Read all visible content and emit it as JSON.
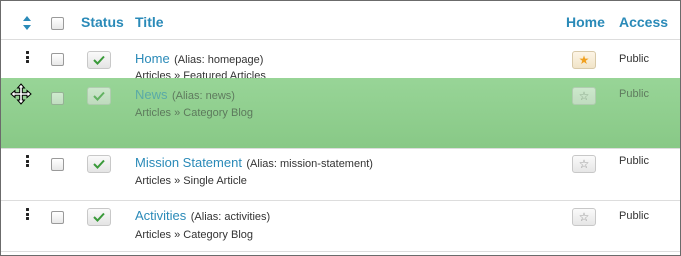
{
  "header": {
    "status_label": "Status",
    "title_label": "Title",
    "home_label": "Home",
    "access_label": "Access"
  },
  "rows": [
    {
      "title": "Home",
      "alias": "(Alias: homepage)",
      "category": "Articles » Featured Articles",
      "home_featured": true,
      "access": "Public",
      "published": true,
      "dragging": false
    },
    {
      "title": "News",
      "alias": "(Alias: news)",
      "category": "Articles » Category Blog",
      "home_featured": false,
      "access": "Public",
      "published": true,
      "dragging": true
    },
    {
      "title": "Mission Statement",
      "alias": "(Alias: mission-statement)",
      "category": "Articles » Single Article",
      "home_featured": false,
      "access": "Public",
      "published": true,
      "dragging": false
    },
    {
      "title": "Activities",
      "alias": "(Alias: activities)",
      "category": "Articles » Category Blog",
      "home_featured": false,
      "access": "Public",
      "published": true,
      "dragging": false
    }
  ],
  "icons": {
    "sort": "sort-icon",
    "drag_handle": "drag-handle-icon",
    "check": "check-icon",
    "star_filled": "star-filled-icon",
    "star_outline": "star-outline-icon",
    "move_cursor": "move-cursor-icon"
  },
  "colors": {
    "link": "#2a8ab8",
    "drag_highlight": "#8fd18e",
    "check": "#3a9a3a",
    "featured_star": "#f0a020"
  }
}
